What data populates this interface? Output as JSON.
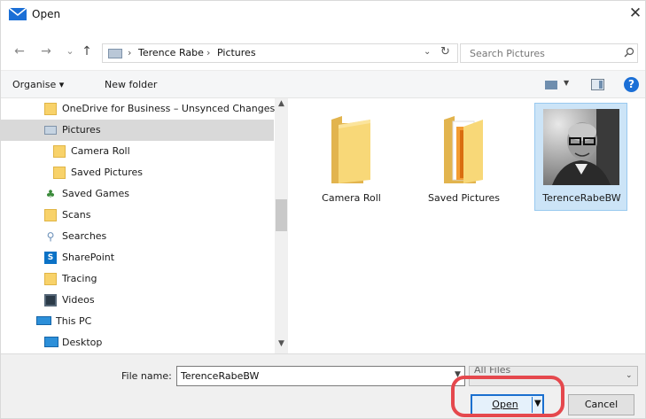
{
  "window": {
    "title": "Open"
  },
  "nav_buttons": {
    "back": "←",
    "forward": "→",
    "recent": "⌄",
    "up": "↑"
  },
  "address": {
    "crumbs": [
      "Terence Rabe",
      "Pictures"
    ],
    "separator": "›"
  },
  "search": {
    "placeholder": "Search Pictures"
  },
  "toolbar": {
    "organise_label": "Organise ▾",
    "new_folder_label": "New folder",
    "help_label": "?"
  },
  "nav_pane": {
    "items": [
      {
        "label": "OneDrive for Business – Unsynced Changes",
        "icon": "folder-icon"
      },
      {
        "label": "Pictures",
        "icon": "pictures-icon",
        "selected": true
      },
      {
        "label": "Camera Roll",
        "icon": "folder-icon"
      },
      {
        "label": "Saved Pictures",
        "icon": "folder-icon"
      },
      {
        "label": "Saved Games",
        "icon": "saved-games-icon"
      },
      {
        "label": "Scans",
        "icon": "folder-icon"
      },
      {
        "label": "Searches",
        "icon": "search-icon"
      },
      {
        "label": "SharePoint",
        "icon": "sharepoint-icon"
      },
      {
        "label": "Tracing",
        "icon": "folder-icon"
      },
      {
        "label": "Videos",
        "icon": "videos-icon"
      },
      {
        "label": "This PC",
        "icon": "computer-icon"
      },
      {
        "label": "Desktop",
        "icon": "desktop-icon"
      }
    ]
  },
  "content": {
    "tiles": [
      {
        "label": "Camera Roll",
        "type": "folder"
      },
      {
        "label": "Saved Pictures",
        "type": "folder-with-files"
      },
      {
        "label": "TerenceRabeBW",
        "type": "image",
        "selected": true
      }
    ]
  },
  "footer": {
    "file_name_label": "File name:",
    "file_name_value": "TerenceRabeBW",
    "file_type_value": "All Files",
    "open_label": "Open",
    "cancel_label": "Cancel"
  },
  "colors": {
    "accent": "#1a6fcf",
    "highlight_ring": "#e5484d",
    "selection": "#cce4f7"
  }
}
